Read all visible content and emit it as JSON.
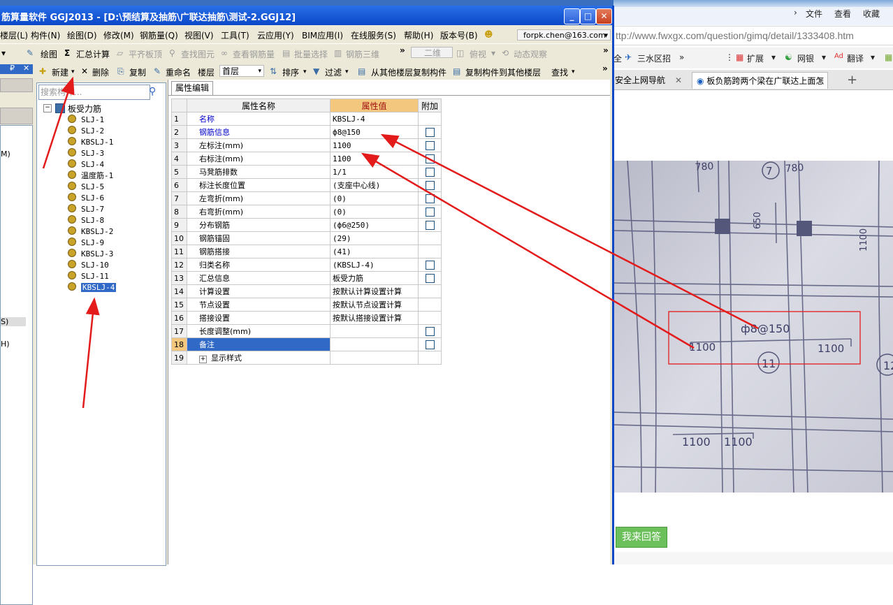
{
  "app": {
    "title": "筋算量软件 GGJ2013 - [D:\\预结算及抽筋\\广联达抽筋\\测试-2.GGJ12]",
    "menu": [
      "楼层(L)",
      "构件(N)",
      "绘图(D)",
      "修改(M)",
      "钢筋量(Q)",
      "视图(V)",
      "工具(T)",
      "云应用(Y)",
      "BIM应用(I)",
      "在线服务(S)",
      "帮助(H)",
      "版本号(B)"
    ],
    "account": "forpk.chen@163.com",
    "toolbar1": {
      "draw": "绘图",
      "summary": "汇总计算",
      "flat_top": "平齐板顶",
      "find_elem": "查找图元",
      "view_rebar": "查看钢筋量",
      "batch_select": "批量选择",
      "rebar_3d": "钢筋三维",
      "view_2d": "二维",
      "top_view": "俯视",
      "dynamic_view": "动态观察"
    },
    "toolbar2": {
      "new": "新建",
      "delete": "删除",
      "copy": "复制",
      "rename": "重命名",
      "floor_label": "楼层",
      "floor_value": "首层",
      "sort": "排序",
      "filter": "过滤",
      "copy_from": "从其他楼层复制构件",
      "copy_to": "复制构件到其他楼层",
      "find": "查找"
    },
    "left_panel_labels": [
      "M)",
      "S)",
      "H)"
    ]
  },
  "tree": {
    "search_placeholder": "搜索构件...",
    "root": "板受力筋",
    "items": [
      "SLJ-1",
      "SLJ-2",
      "KBSLJ-1",
      "SLJ-3",
      "SLJ-4",
      "温度筋-1",
      "SLJ-5",
      "SLJ-6",
      "SLJ-7",
      "SLJ-8",
      "KBSLJ-2",
      "SLJ-9",
      "KBSLJ-3",
      "SLJ-10",
      "SLJ-11",
      "KBSLJ-4"
    ],
    "selected": "KBSLJ-4"
  },
  "props": {
    "tab": "属性编辑",
    "col_name": "属性名称",
    "col_value": "属性值",
    "col_extra": "附加",
    "rows": [
      {
        "n": "1",
        "name": "名称",
        "value": "KBSLJ-4",
        "blue": true,
        "check": false
      },
      {
        "n": "2",
        "name": "钢筋信息",
        "value": "ф8@150",
        "blue": true,
        "check": true
      },
      {
        "n": "3",
        "name": "左标注(mm)",
        "value": "1100",
        "blue": false,
        "check": true
      },
      {
        "n": "4",
        "name": "右标注(mm)",
        "value": "1100",
        "blue": false,
        "check": true
      },
      {
        "n": "5",
        "name": "马凳筋排数",
        "value": "1/1",
        "blue": false,
        "check": true
      },
      {
        "n": "6",
        "name": "标注长度位置",
        "value": "(支座中心线)",
        "blue": false,
        "check": true
      },
      {
        "n": "7",
        "name": "左弯折(mm)",
        "value": "(0)",
        "blue": false,
        "check": true
      },
      {
        "n": "8",
        "name": "右弯折(mm)",
        "value": "(0)",
        "blue": false,
        "check": true
      },
      {
        "n": "9",
        "name": "分布钢筋",
        "value": "(ф6@250)",
        "blue": false,
        "check": true
      },
      {
        "n": "10",
        "name": "钢筋锚固",
        "value": "(29)",
        "blue": false,
        "check": false
      },
      {
        "n": "11",
        "name": "钢筋搭接",
        "value": "(41)",
        "blue": false,
        "check": false
      },
      {
        "n": "12",
        "name": "归类名称",
        "value": "(KBSLJ-4)",
        "blue": false,
        "check": true
      },
      {
        "n": "13",
        "name": "汇总信息",
        "value": "板受力筋",
        "blue": false,
        "check": true
      },
      {
        "n": "14",
        "name": "计算设置",
        "value": "按默认计算设置计算",
        "blue": false,
        "check": false
      },
      {
        "n": "15",
        "name": "节点设置",
        "value": "按默认节点设置计算",
        "blue": false,
        "check": false
      },
      {
        "n": "16",
        "name": "搭接设置",
        "value": "按默认搭接设置计算",
        "blue": false,
        "check": false
      },
      {
        "n": "17",
        "name": "长度调整(mm)",
        "value": "",
        "blue": false,
        "check": true
      },
      {
        "n": "18",
        "name": "备注",
        "value": "",
        "blue": false,
        "check": true,
        "selected": true
      },
      {
        "n": "19",
        "name": "显示样式",
        "value": "",
        "blue": false,
        "check": false,
        "expand": true
      }
    ]
  },
  "browser": {
    "menu": [
      "文件",
      "查看",
      "收藏"
    ],
    "url": "ttp://www.fwxgx.com/question/gimq/detail/1333408.htm",
    "favs": [
      "三水区招",
      "扩展",
      "网银",
      "翻译"
    ],
    "tabs": [
      "安全上网导航",
      "板负筋跨两个梁在广联达上面怎"
    ],
    "answer_button": "我来回答",
    "photo_labels": {
      "rebar": "ф8@150",
      "left": "1100",
      "right": "1100",
      "axis": "11",
      "axis2": "12",
      "axis7": "7",
      "dim1": "780",
      "dim2": "780",
      "dim3": "650",
      "dim4": "1100",
      "bottom1": "1100",
      "bottom2": "1100"
    }
  },
  "colors": {
    "title_blue": "#0a48c8",
    "annotation_red": "#e31b1b",
    "selection": "#3169c6"
  }
}
